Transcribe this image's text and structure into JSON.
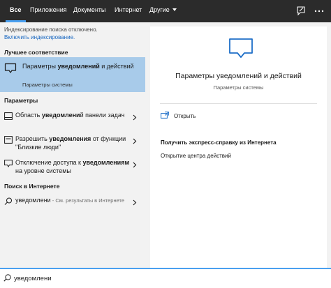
{
  "tabs": [
    {
      "label": "Все",
      "active": true
    },
    {
      "label": "Приложения"
    },
    {
      "label": "Документы"
    },
    {
      "label": "Интернет"
    },
    {
      "label": "Другие"
    }
  ],
  "indexing": {
    "message": "Индексирование поиска отключено.",
    "link": "Включить индексирование."
  },
  "best_match": {
    "header": "Лучшее соответствие",
    "title_pre": "Параметры ",
    "title_bold": "уведомлений",
    "title_post": " и действий",
    "subtitle": "Параметры системы"
  },
  "settings": {
    "header": "Параметры",
    "items": [
      {
        "pre": "Область ",
        "bold": "уведомлени",
        "post": "й панели задач"
      },
      {
        "pre": "Разрешить ",
        "bold": "уведомления",
        "post": " от функции \"Близкие люди\""
      },
      {
        "pre": "Отключение доступа к ",
        "bold": "уведомлениям",
        "post": " на уровне системы"
      }
    ]
  },
  "web": {
    "header": "Поиск в Интернете",
    "query": "уведомлени",
    "hint": " - См. результаты в Интернете"
  },
  "preview": {
    "title": "Параметры уведомлений и действий",
    "subtitle": "Параметры системы",
    "open_label": "Открыть",
    "help_header": "Получить экспресс-справку из Интернета",
    "help_items": [
      "Открытие центра действий"
    ]
  },
  "search": {
    "value": "уведомлени"
  },
  "colors": {
    "accent": "#4aa0f0",
    "highlight": "#a8cbea",
    "topbar": "#2b2b2b",
    "link": "#1565c0"
  },
  "icons": {
    "best_match": "message-bubble-icon",
    "settings": [
      "taskbar-icon",
      "notification-icon",
      "message-icon"
    ],
    "web": "search-icon",
    "open": "open-window-icon",
    "feedback": "feedback-icon",
    "more": "more-icon"
  }
}
